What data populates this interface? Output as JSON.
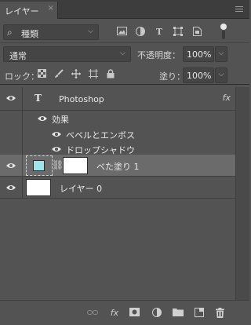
{
  "panel": {
    "tab_label": "レイヤー",
    "tab_close": "×"
  },
  "filter": {
    "search_icon": "⌕",
    "kind_label": "種類",
    "chevron": "⌵",
    "icons": [
      "image-filter-icon",
      "adjustment-filter-icon",
      "type-filter-icon",
      "shape-filter-icon",
      "smart-object-filter-icon"
    ]
  },
  "blend": {
    "mode": "通常",
    "opacity_label": "不透明度：",
    "opacity_value": "100%"
  },
  "lock": {
    "label": "ロック：",
    "fill_label": "塗り：",
    "fill_value": "100%"
  },
  "layers": {
    "text_layer": {
      "name": "Photoshop",
      "type_glyph": "T",
      "fx": "fx"
    },
    "effects_label": "効果",
    "effects": [
      "ベベルとエンボス",
      "ドロップシャドウ"
    ],
    "fill_layer": {
      "name": "べた塗り 1",
      "color": "#9fe3ec",
      "link_glyph": "⛓"
    },
    "base_layer": {
      "name": "レイヤー 0"
    }
  },
  "bottom": {
    "fx_label": "fx",
    "icons": [
      "link-layers-icon",
      "add-style-icon",
      "add-mask-icon",
      "new-adjustment-icon",
      "new-group-icon",
      "new-layer-icon",
      "delete-layer-icon"
    ]
  }
}
